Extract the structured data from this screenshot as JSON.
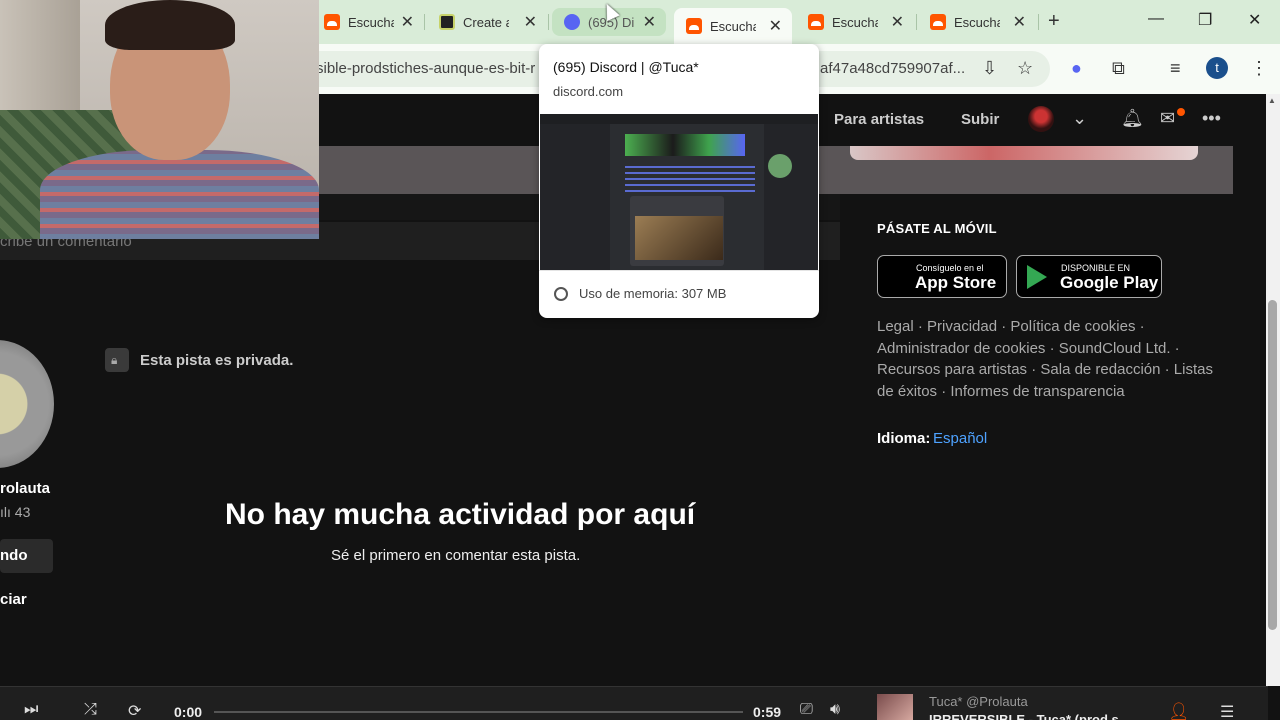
{
  "browser": {
    "tabs": [
      {
        "label": "Escucha",
        "favicon": "soundcloud-icon"
      },
      {
        "label": "Create a",
        "favicon": "create-icon"
      },
      {
        "label": "(695) Di",
        "favicon": "discord-icon",
        "badge": "695"
      },
      {
        "label": "Escucha",
        "favicon": "soundcloud-icon",
        "active": true
      },
      {
        "label": "Escucha",
        "favicon": "soundcloud-icon"
      },
      {
        "label": "Escucha",
        "favicon": "soundcloud-icon"
      }
    ],
    "url_left": "sible-prodstiches-aunque-es-bit-r",
    "url_right": "af47a48cd759907af...",
    "profile_initial": "t"
  },
  "hover_card": {
    "title": "(695) Discord | @Tuca*",
    "domain": "discord.com",
    "memory": "Uso de memoria: 307 MB"
  },
  "header": {
    "nav_artists": "Para artistas",
    "nav_upload": "Subir"
  },
  "comment": {
    "placeholder": "cribe un comentario"
  },
  "artist": {
    "name": "rolauta",
    "followers": "43",
    "follow_label": "ndo",
    "share_label": "ciar"
  },
  "track": {
    "private_label": "Esta pista es privada."
  },
  "empty_state": {
    "title": "No hay mucha actividad por aquí",
    "subtitle": "Sé el primero en comentar esta pista."
  },
  "sidebar": {
    "mobile_title": "PÁSATE AL MÓVIL",
    "app_store_small": "Consíguelo en el",
    "app_store_big": "App Store",
    "play_small": "DISPONIBLE EN",
    "play_big": "Google Play",
    "footer_links": "Legal · Privacidad · Política de cookies · Administrador de cookies · SoundCloud Ltd. · Recursos para artistas · Sala de redacción · Listas de éxitos · Informes de transparencia",
    "language_label": "Idioma:",
    "language_value": "Español"
  },
  "player": {
    "time_current": "0:00",
    "time_total": "0:59",
    "artist": "Tuca* @Prolauta",
    "track": "IRREVERSIBLE - Tuca* (prod.s"
  },
  "colors": {
    "accent": "#ff5500",
    "link": "#4ea2ff",
    "tabstrip": "#d9ecd8"
  }
}
